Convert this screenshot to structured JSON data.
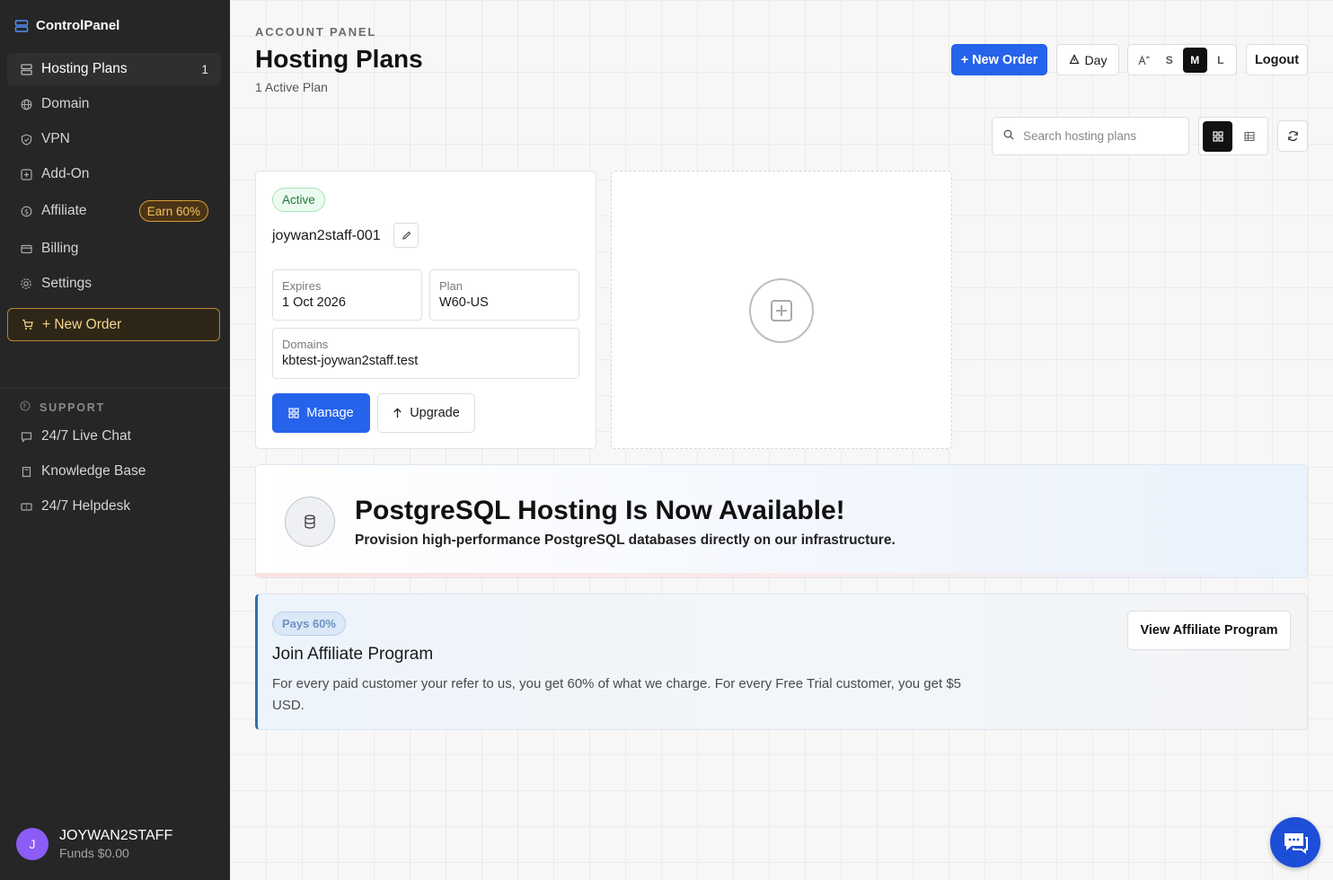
{
  "sidebar": {
    "brand": "ControlPanel",
    "items": [
      {
        "label": "Hosting Plans",
        "count": "1",
        "icon": "server-icon"
      },
      {
        "label": "Domain",
        "icon": "globe-icon"
      },
      {
        "label": "VPN",
        "icon": "shield-icon"
      },
      {
        "label": "Add-On",
        "icon": "plus-square-icon"
      },
      {
        "label": "Affiliate",
        "badge": "Earn 60%",
        "icon": "dollar-icon"
      },
      {
        "label": "Billing",
        "icon": "credit-card-icon"
      },
      {
        "label": "Settings",
        "icon": "gear-icon"
      }
    ],
    "new_order": "+ New Order",
    "support_heading": "SUPPORT",
    "support_items": [
      {
        "label": "24/7 Live Chat",
        "icon": "chat-icon"
      },
      {
        "label": "Knowledge Base",
        "icon": "book-icon"
      },
      {
        "label": "24/7 Helpdesk",
        "icon": "ticket-icon"
      }
    ],
    "user": {
      "initial": "J",
      "name": "JOYWAN2STAFF",
      "funds": "Funds $0.00"
    }
  },
  "header": {
    "eyebrow": "ACCOUNT PANEL",
    "title": "Hosting Plans",
    "subtitle": "1 Active Plan",
    "new_order": "+ New Order",
    "theme_label": "Day",
    "size_options": [
      "S",
      "M",
      "L"
    ],
    "size_selected": "M",
    "logout": "Logout"
  },
  "search": {
    "placeholder": "Search hosting plans"
  },
  "plan": {
    "status": "Active",
    "name": "joywan2staff-001",
    "expires_label": "Expires",
    "expires_value": "1 Oct 2026",
    "plan_label": "Plan",
    "plan_value": "W60-US",
    "domains_label": "Domains",
    "domains_value": "kbtest-joywan2staff.test",
    "manage": "Manage",
    "upgrade": "Upgrade"
  },
  "banner": {
    "title": "PostgreSQL Hosting Is Now Available!",
    "subtitle": "Provision high-performance PostgreSQL databases directly on our infrastructure."
  },
  "affiliate": {
    "pill": "Pays 60%",
    "title": "Join Affiliate Program",
    "text": "For every paid customer your refer to us, you get 60% of what we charge. For every Free Trial customer, you get $5 USD.",
    "button": "View Affiliate Program"
  },
  "colors": {
    "accent": "#2563eb",
    "sidebar_bg": "#262626",
    "affiliate_badge": "#f5c060"
  }
}
